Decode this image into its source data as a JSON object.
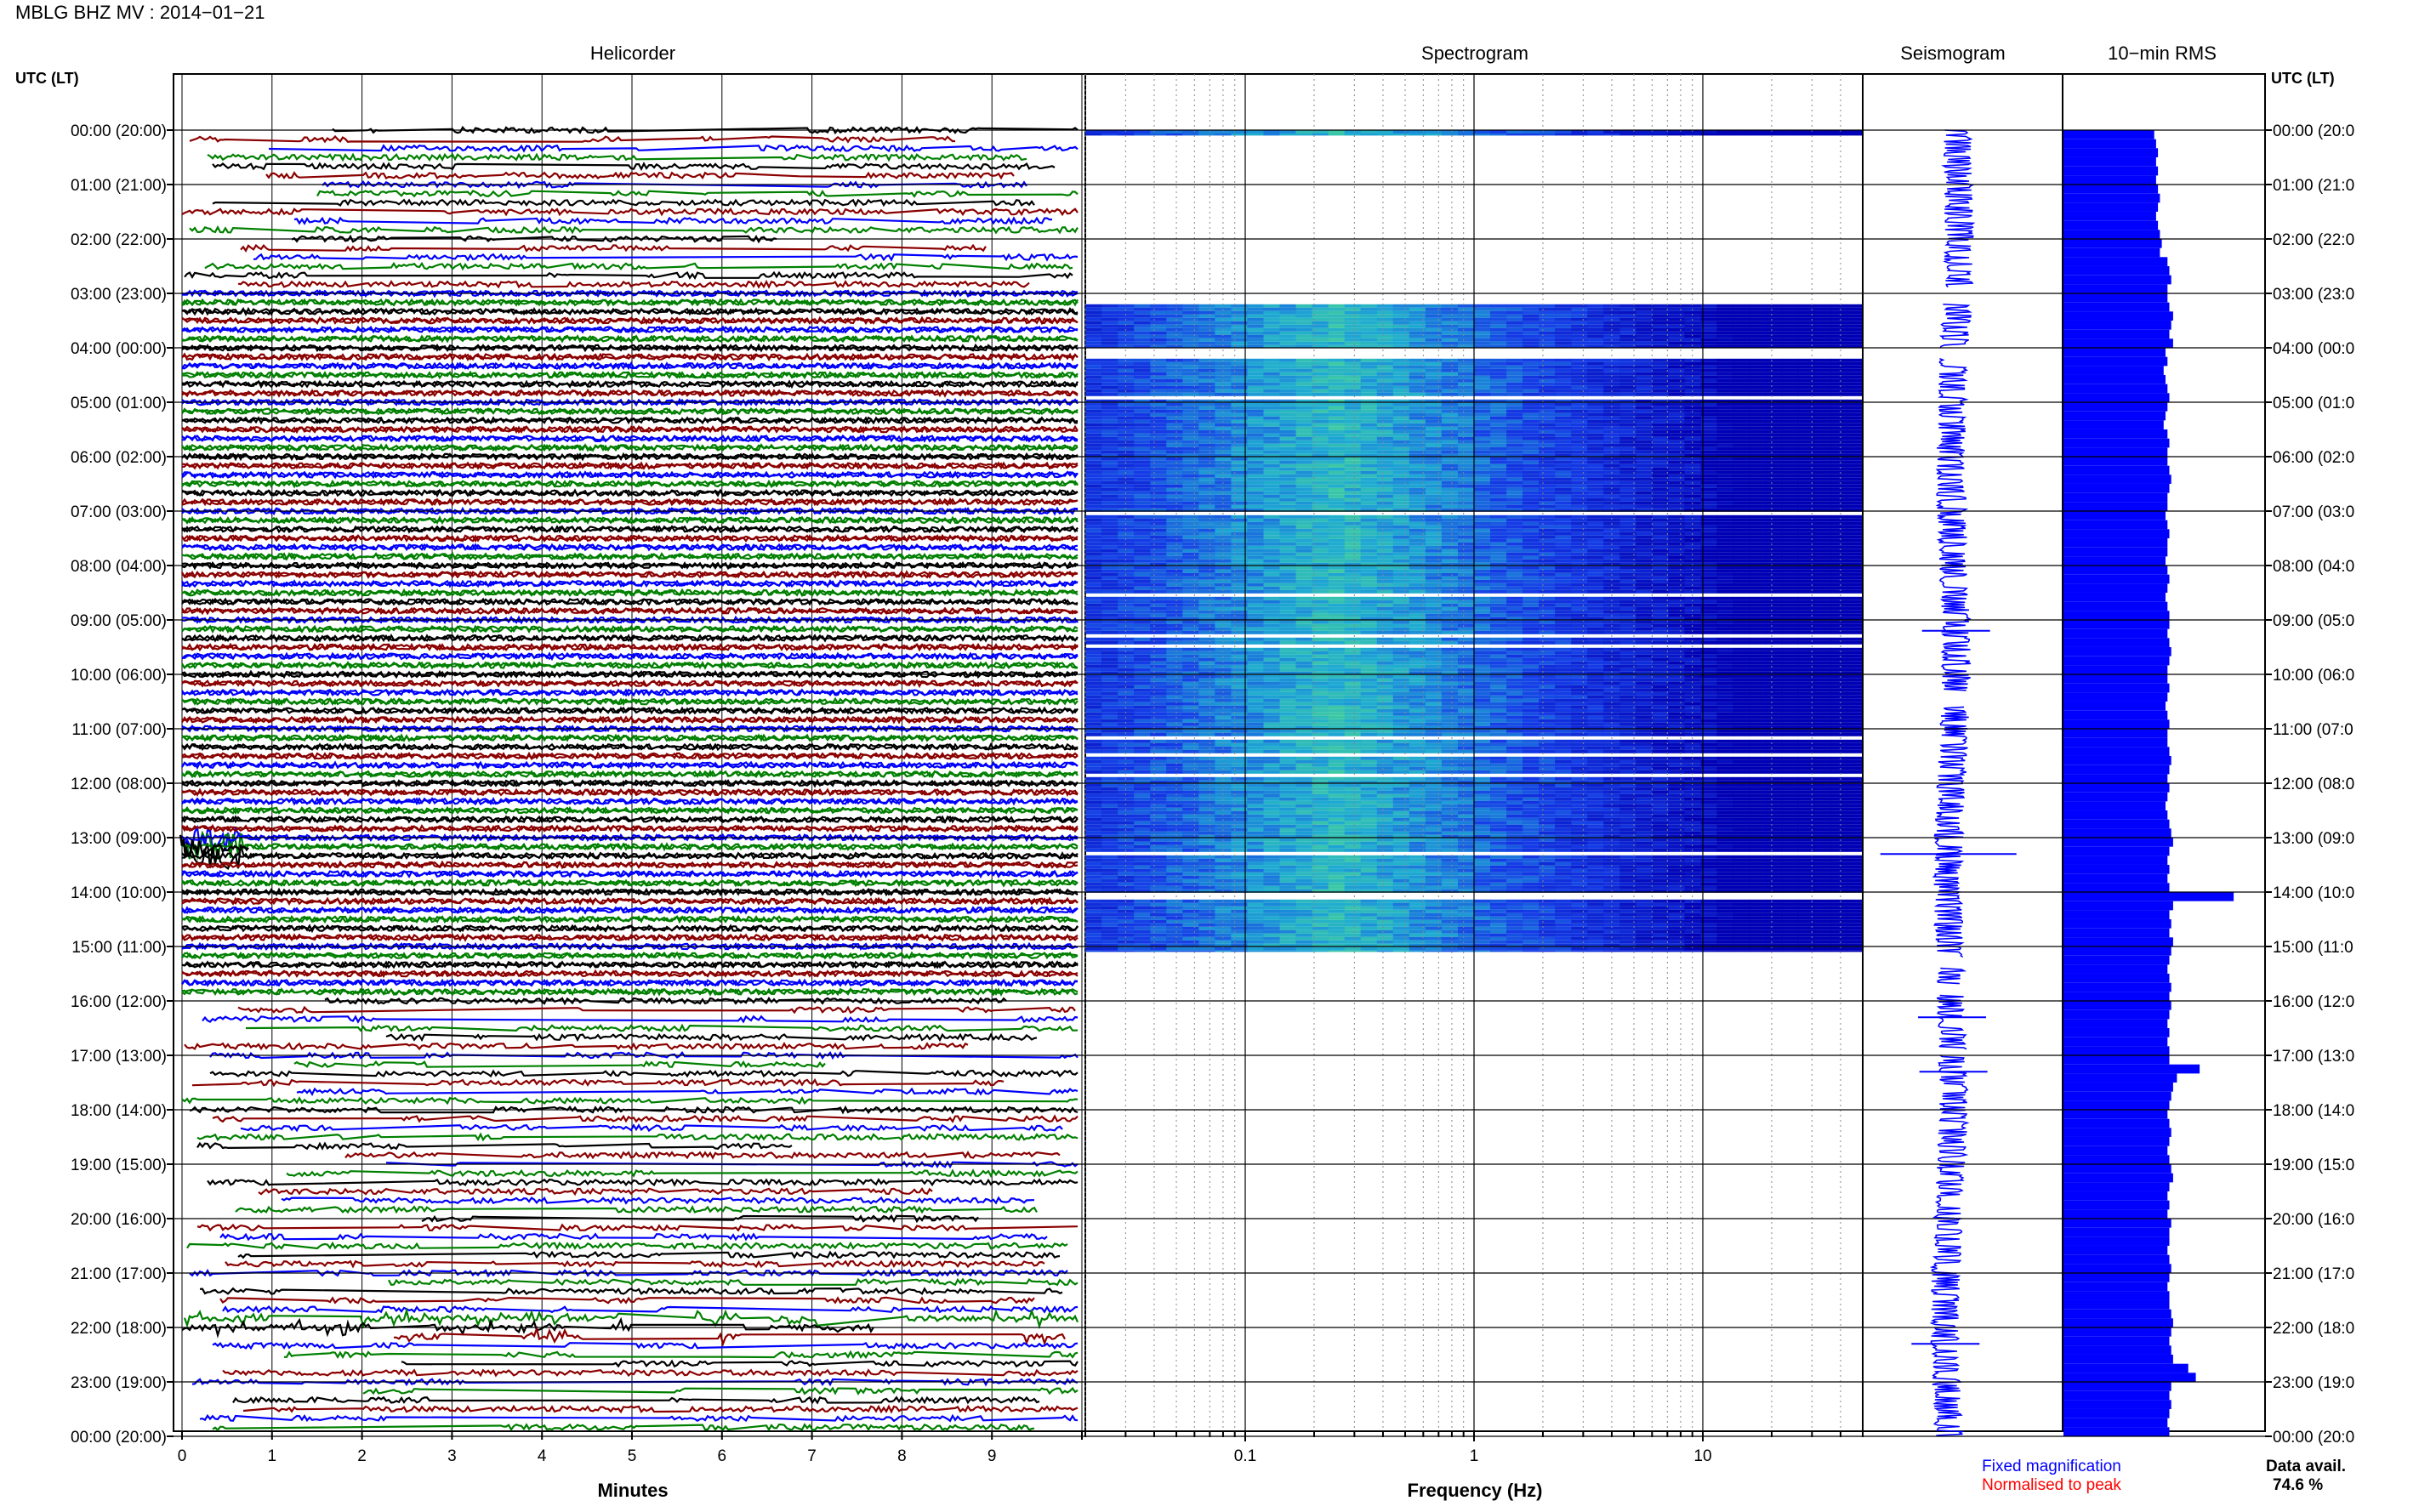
{
  "header": {
    "title": "MBLG BHZ MV : 2014−01−21"
  },
  "panels": {
    "helicorder": {
      "title": "Helicorder"
    },
    "spectrogram": {
      "title": "Spectrogram"
    },
    "seismogram": {
      "title": "Seismogram"
    },
    "rms": {
      "title": "10−min RMS"
    }
  },
  "axes": {
    "left_axis_label": "UTC (LT)",
    "right_axis_label": "UTC (LT)",
    "time_ticks_left": [
      "00:00 (20:00)",
      "01:00 (21:00)",
      "02:00 (22:00)",
      "03:00 (23:00)",
      "04:00 (00:00)",
      "05:00 (01:00)",
      "06:00 (02:00)",
      "07:00 (03:00)",
      "08:00 (04:00)",
      "09:00 (05:00)",
      "10:00 (06:00)",
      "11:00 (07:00)",
      "12:00 (08:00)",
      "13:00 (09:00)",
      "14:00 (10:00)",
      "15:00 (11:00)",
      "16:00 (12:00)",
      "17:00 (13:00)",
      "18:00 (14:00)",
      "19:00 (15:00)",
      "20:00 (16:00)",
      "21:00 (17:00)",
      "22:00 (18:00)",
      "23:00 (19:00)",
      "00:00 (20:00)"
    ],
    "time_ticks_right": [
      "00:00 (20:0",
      "01:00 (21:0",
      "02:00 (22:0",
      "03:00 (23:0",
      "04:00 (00:0",
      "05:00 (01:0",
      "06:00 (02:0",
      "07:00 (03:0",
      "08:00 (04:0",
      "09:00 (05:0",
      "10:00 (06:0",
      "11:00 (07:0",
      "12:00 (08:0",
      "13:00 (09:0",
      "14:00 (10:0",
      "15:00 (11:0",
      "16:00 (12:0",
      "17:00 (13:0",
      "18:00 (14:0",
      "19:00 (15:0",
      "20:00 (16:0",
      "21:00 (17:0",
      "22:00 (18:0",
      "23:00 (19:0",
      "00:00 (20:0"
    ],
    "minutes_ticks": [
      "0",
      "1",
      "2",
      "3",
      "4",
      "5",
      "6",
      "7",
      "8",
      "9"
    ],
    "minutes_label": "Minutes",
    "frequency_ticks": [
      "0.1",
      "1",
      "10"
    ],
    "frequency_label": "Frequency (Hz)"
  },
  "legend": {
    "fixed": "Fixed magnification",
    "normalised": "Normalised to peak",
    "fixed_color": "#0000ff",
    "normalised_color": "#ff0000"
  },
  "footer": {
    "data_avail_label": "Data avail.",
    "data_avail_value": "74.6 %"
  },
  "colors": {
    "trace_colors": [
      "#000000",
      "#8b0000",
      "#0000ff",
      "#008000"
    ],
    "rms_fill": "#0000ff"
  },
  "chart_data": [
    {
      "type": "line",
      "name": "helicorder",
      "x_unit": "minutes",
      "xlim": [
        0,
        10
      ],
      "rows_per_hour": 6,
      "hours": 24,
      "traces_per_row_colors": [
        "#000000",
        "#8b0000",
        "#0000ff",
        "#008000"
      ],
      "notable_events_utc": [
        "13:00",
        "22:00"
      ]
    },
    {
      "type": "heatmap",
      "name": "spectrogram",
      "x_scale": "log",
      "xlim": [
        0.02,
        50
      ],
      "x_ticks": [
        0.1,
        1,
        10
      ],
      "data_present_utc_hours": [
        [
          0,
          0.1
        ],
        [
          3.2,
          4.0
        ],
        [
          4.2,
          15.1
        ]
      ],
      "peak_energy_band_hz": [
        0.2,
        0.4
      ]
    },
    {
      "type": "line",
      "name": "seismogram",
      "events_utc": [
        9.2,
        13.3,
        16.3,
        17.3,
        22.3
      ]
    },
    {
      "type": "bar",
      "name": "10-min RMS",
      "orientation": "horizontal",
      "bins_per_hour": 6,
      "hours": 24,
      "relative_values": [
        0.48,
        0.49,
        0.5,
        0.49,
        0.5,
        0.49,
        0.5,
        0.51,
        0.5,
        0.49,
        0.5,
        0.51,
        0.52,
        0.51,
        0.55,
        0.56,
        0.57,
        0.55,
        0.55,
        0.56,
        0.58,
        0.57,
        0.56,
        0.58,
        0.54,
        0.55,
        0.53,
        0.54,
        0.55,
        0.56,
        0.55,
        0.54,
        0.53,
        0.55,
        0.56,
        0.55,
        0.55,
        0.56,
        0.57,
        0.56,
        0.55,
        0.55,
        0.54,
        0.55,
        0.56,
        0.55,
        0.55,
        0.54,
        0.55,
        0.56,
        0.55,
        0.54,
        0.55,
        0.56,
        0.56,
        0.55,
        0.56,
        0.57,
        0.56,
        0.55,
        0.55,
        0.56,
        0.55,
        0.54,
        0.55,
        0.56,
        0.55,
        0.55,
        0.56,
        0.57,
        0.56,
        0.55,
        0.56,
        0.55,
        0.54,
        0.55,
        0.56,
        0.57,
        0.58,
        0.56,
        0.55,
        0.56,
        0.55,
        0.56,
        0.9,
        0.58,
        0.56,
        0.57,
        0.56,
        0.58,
        0.57,
        0.56,
        0.55,
        0.56,
        0.57,
        0.56,
        0.57,
        0.56,
        0.55,
        0.56,
        0.55,
        0.56,
        0.56,
        0.72,
        0.6,
        0.58,
        0.57,
        0.56,
        0.55,
        0.56,
        0.57,
        0.56,
        0.55,
        0.56,
        0.57,
        0.58,
        0.56,
        0.55,
        0.56,
        0.55,
        0.57,
        0.56,
        0.56,
        0.55,
        0.56,
        0.57,
        0.56,
        0.55,
        0.56,
        0.56,
        0.57,
        0.58,
        0.57,
        0.56,
        0.57,
        0.58,
        0.66,
        0.7,
        0.57,
        0.56,
        0.57,
        0.56,
        0.55,
        0.56
      ]
    }
  ]
}
